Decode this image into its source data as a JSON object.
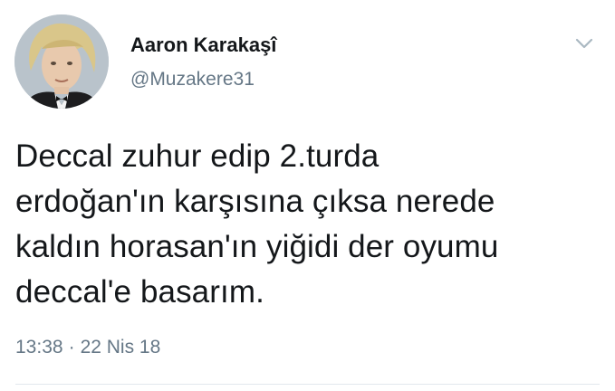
{
  "user": {
    "display_name": "Aaron Karakaşî",
    "handle": "@Muzakere31",
    "avatar_icon": "profile-photo"
  },
  "tweet": {
    "text": "Deccal zuhur edip 2.turda\nerdoğan'ın karşısına çıksa nerede\nkaldın horasan'ın yiğidi der oyumu\ndeccal'e basarım.",
    "time": "13:38",
    "separator": "·",
    "date": "22 Nis 18"
  },
  "menu_icon": "chevron-down-icon",
  "colors": {
    "text": "#14171a",
    "secondary": "#657786",
    "divider": "#e1e8ed"
  }
}
